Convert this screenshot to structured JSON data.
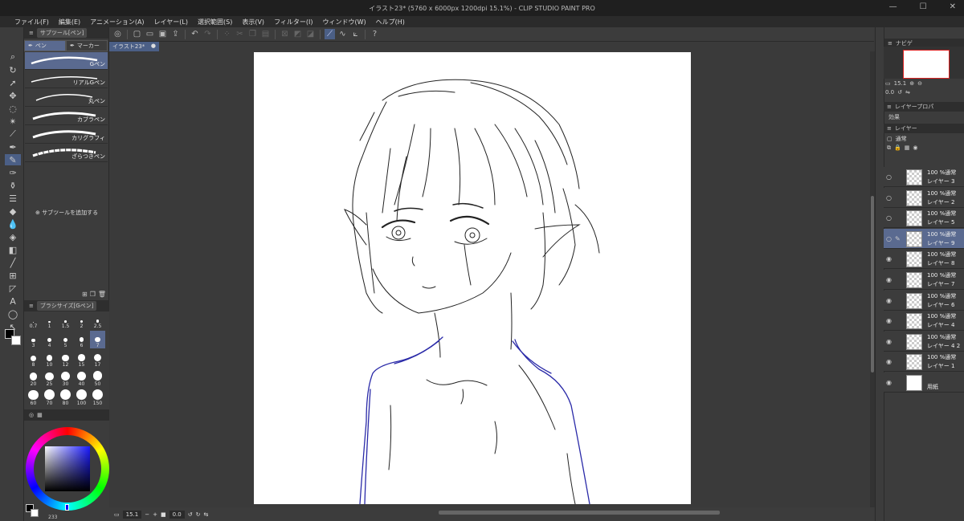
{
  "window": {
    "title": "イラスト23* (5760 x 6000px 1200dpi 15.1%)  - CLIP STUDIO PAINT PRO"
  },
  "menu": [
    "ファイル(F)",
    "編集(E)",
    "アニメーション(A)",
    "レイヤー(L)",
    "選択範囲(S)",
    "表示(V)",
    "フィルター(I)",
    "ウィンドウ(W)",
    "ヘルプ(H)"
  ],
  "subtool": {
    "panel_title": "サブツール[ペン]",
    "groups": [
      "ペン",
      "マーカー"
    ],
    "brushes": [
      "Gペン",
      "リアルGペン",
      "丸ペン",
      "カブラペン",
      "カリグラフィ",
      "ざらつきペン"
    ],
    "add_label": "サブツールを追加する"
  },
  "brush_size": {
    "panel_title": "ブラシサイズ[Gペン]",
    "sizes": [
      "0.7",
      "1",
      "1.5",
      "2",
      "2.5",
      "3",
      "4",
      "5",
      "6",
      "7",
      "8",
      "10",
      "12",
      "15",
      "17",
      "20",
      "25",
      "30",
      "40",
      "50",
      "60",
      "70",
      "80",
      "100",
      "150"
    ],
    "selected": "7"
  },
  "document": {
    "tab": "イラスト23*"
  },
  "status": {
    "zoom": "15.1",
    "angle": "0.0",
    "bottom_left": "233"
  },
  "navigator": {
    "tab": "ナビゲ",
    "zoom": "15.1",
    "angle": "0.0"
  },
  "layer_property": {
    "tab": "レイヤープロパ",
    "effect_label": "効果"
  },
  "layers_panel": {
    "tab": "レイヤー",
    "blend": "通常"
  },
  "layers": [
    {
      "mode": "100 %通常",
      "name": "レイヤー 3",
      "visible": false
    },
    {
      "mode": "100 %通常",
      "name": "レイヤー 2",
      "visible": false
    },
    {
      "mode": "100 %通常",
      "name": "レイヤー 5",
      "visible": false
    },
    {
      "mode": "100 %通常",
      "name": "レイヤー 9",
      "visible": false,
      "selected": true
    },
    {
      "mode": "100 %通常",
      "name": "レイヤー 8",
      "visible": true
    },
    {
      "mode": "100 %通常",
      "name": "レイヤー 7",
      "visible": true
    },
    {
      "mode": "100 %通常",
      "name": "レイヤー 6",
      "visible": true
    },
    {
      "mode": "100 %通常",
      "name": "レイヤー 4",
      "visible": true
    },
    {
      "mode": "100 %通常",
      "name": "レイヤー 4 2",
      "visible": true
    },
    {
      "mode": "100 %通常",
      "name": "レイヤー 1",
      "visible": true
    },
    {
      "mode": "",
      "name": "用紙",
      "visible": true,
      "paper": true
    }
  ],
  "colors": {
    "accent": "#5a6a90",
    "canvas_bg": "#3a3a3a",
    "line_blue": "#2a2aa8"
  }
}
